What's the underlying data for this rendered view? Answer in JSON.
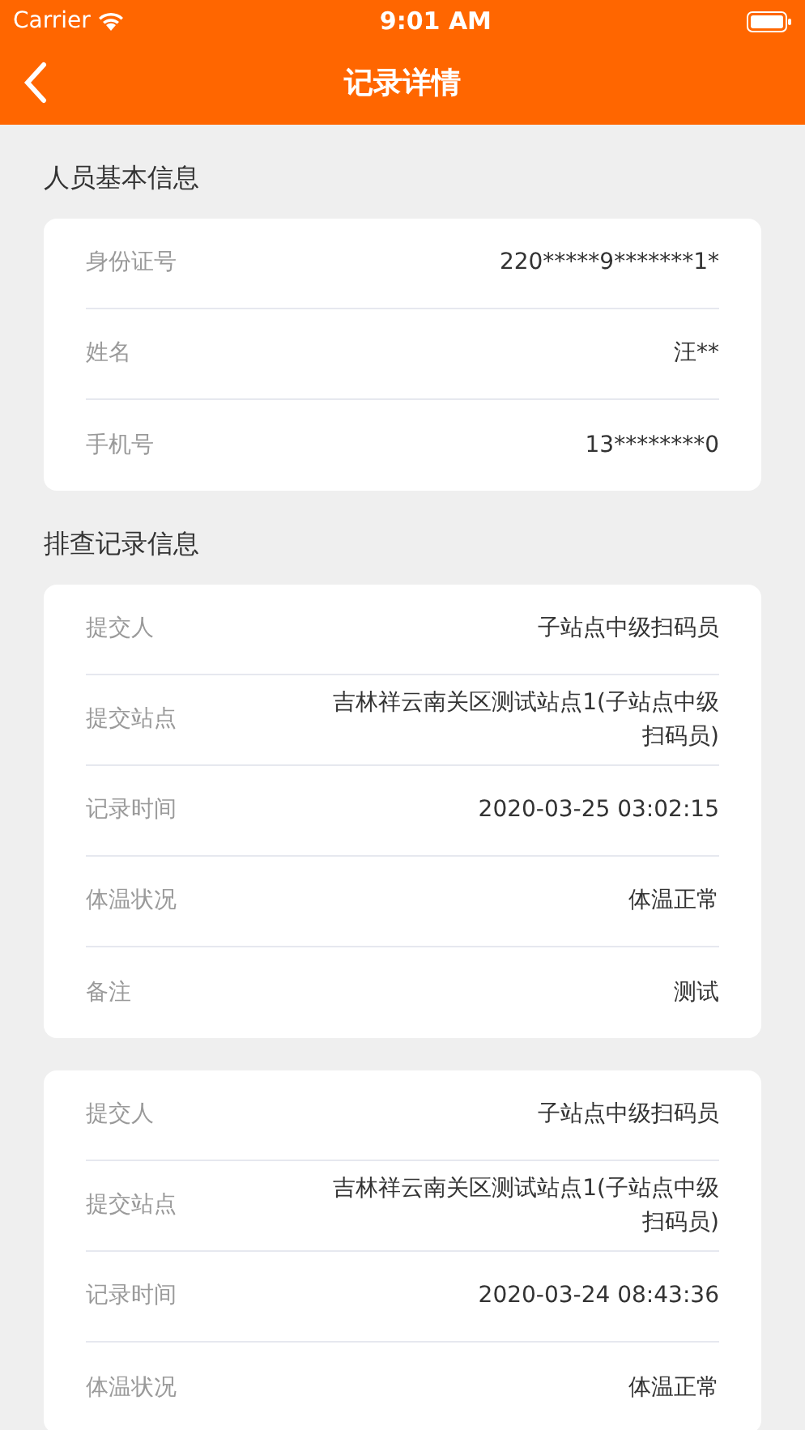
{
  "status_bar": {
    "carrier": "Carrier",
    "time": "9:01 AM"
  },
  "nav": {
    "title": "记录详情"
  },
  "sections": [
    {
      "title": "人员基本信息",
      "cards": [
        {
          "rows": [
            {
              "label": "身份证号",
              "value": "220*****9*******1*"
            },
            {
              "label": "姓名",
              "value": "汪**"
            },
            {
              "label": "手机号",
              "value": "13********0"
            }
          ]
        }
      ]
    },
    {
      "title": "排查记录信息",
      "cards": [
        {
          "rows": [
            {
              "label": "提交人",
              "value": "子站点中级扫码员"
            },
            {
              "label": "提交站点",
              "value": "吉林祥云南关区测试站点1(子站点中级扫码员)"
            },
            {
              "label": "记录时间",
              "value": "2020-03-25 03:02:15"
            },
            {
              "label": "体温状况",
              "value": "体温正常"
            },
            {
              "label": "备注",
              "value": "测试"
            }
          ]
        },
        {
          "rows": [
            {
              "label": "提交人",
              "value": "子站点中级扫码员"
            },
            {
              "label": "提交站点",
              "value": "吉林祥云南关区测试站点1(子站点中级扫码员)"
            },
            {
              "label": "记录时间",
              "value": "2020-03-24 08:43:36"
            },
            {
              "label": "体温状况",
              "value": "体温正常"
            }
          ]
        }
      ]
    }
  ]
}
